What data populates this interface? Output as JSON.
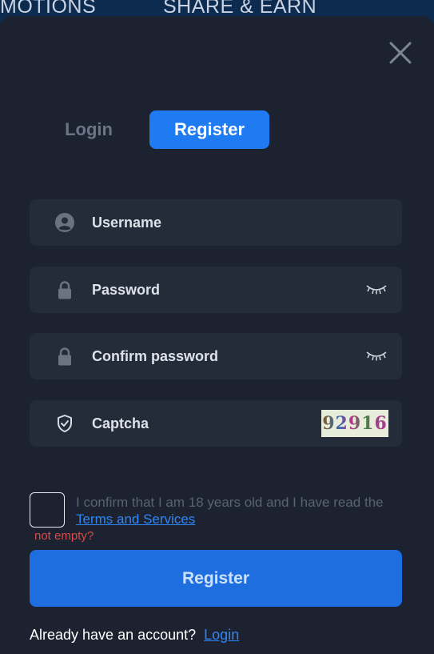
{
  "topnav": {
    "promotions": "MOTIONS",
    "share": "SHARE & EARN"
  },
  "tabs": {
    "login": "Login",
    "register": "Register",
    "active": "register"
  },
  "form": {
    "username": {
      "label": "Username",
      "icon": "user-icon"
    },
    "password": {
      "label": "Password",
      "icon": "lock-icon"
    },
    "confirm_password": {
      "label": "Confirm password",
      "icon": "lock-icon"
    },
    "captcha": {
      "label": "Captcha",
      "icon": "shield-check-icon",
      "code": "92916"
    }
  },
  "terms": {
    "text": "I confirm that I am 18 years old and I have read the",
    "link": "Terms and Services",
    "checked": false,
    "error": "not empty?"
  },
  "submit_label": "Register",
  "footer": {
    "text": "Already have an account?",
    "link": "Login"
  },
  "colors": {
    "accent": "#1f7bf2",
    "modal_bg": "#1c2230",
    "field_bg": "#252c39",
    "error": "#d84a4a"
  }
}
